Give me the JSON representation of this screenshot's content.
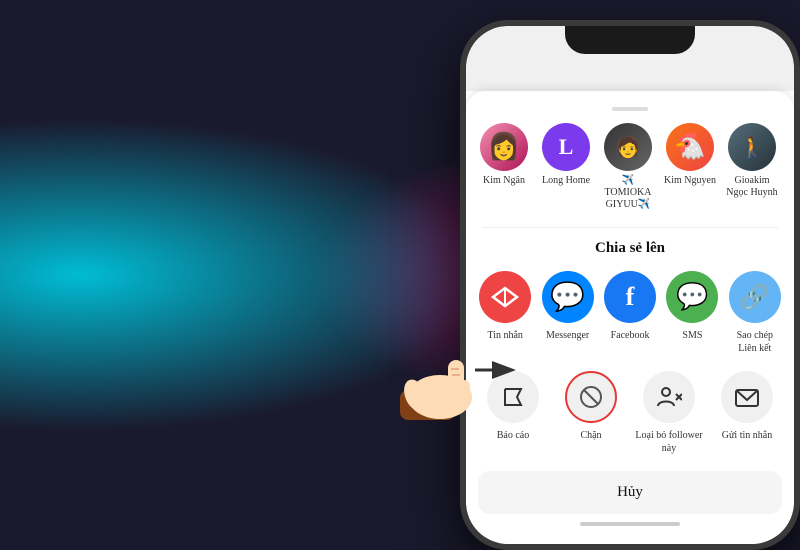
{
  "background": {
    "left_glow": "#00bcd4",
    "right_glow": "#e91e8c"
  },
  "contacts": [
    {
      "id": "kim-ngan",
      "label": "Kim Ngân",
      "initials": "",
      "color_class": "av-photo-kim",
      "emoji": "👩"
    },
    {
      "id": "long-home",
      "label": "Long Home",
      "initials": "L",
      "color_class": "av-purple",
      "emoji": ""
    },
    {
      "id": "tomioka",
      "label": "✈️ TOMIOKA GIYUU✈️",
      "initials": "",
      "color_class": "av-photo-tom",
      "emoji": "🧑"
    },
    {
      "id": "kim-nguyen",
      "label": "Kim Nguyen",
      "initials": "",
      "color_class": "av-photo-nguyen",
      "emoji": "🐔"
    },
    {
      "id": "gioakim",
      "label": "Gioakim Ngọc Huynh",
      "initials": "",
      "color_class": "av-photo-gioakim",
      "emoji": "🚶"
    }
  ],
  "share_section": {
    "title": "Chia sẻ lên",
    "items": [
      {
        "id": "tin-nhan",
        "label": "Tin nhắn",
        "color_class": "icon-tin",
        "symbol": "▽"
      },
      {
        "id": "messenger",
        "label": "Messenger",
        "color_class": "icon-mess",
        "symbol": "💬"
      },
      {
        "id": "facebook",
        "label": "Facebook",
        "color_class": "icon-fb",
        "symbol": "f"
      },
      {
        "id": "sms",
        "label": "SMS",
        "color_class": "icon-sms",
        "symbol": "✉"
      },
      {
        "id": "copy-link",
        "label": "Sao chép Liên kết",
        "color_class": "icon-copy",
        "symbol": "🔗"
      }
    ]
  },
  "actions": [
    {
      "id": "bao-cao",
      "label": "Báo cáo",
      "symbol": "⚑",
      "highlighted": false
    },
    {
      "id": "chan",
      "label": "Chặn",
      "symbol": "⊘",
      "highlighted": true
    },
    {
      "id": "loai-bo",
      "label": "Loại bỏ follower này",
      "symbol": "👤✕",
      "highlighted": false
    },
    {
      "id": "gui-tin-nhan",
      "label": "Gửi tin nhắn",
      "symbol": "✉",
      "highlighted": false
    }
  ],
  "cancel_label": "Hủy"
}
